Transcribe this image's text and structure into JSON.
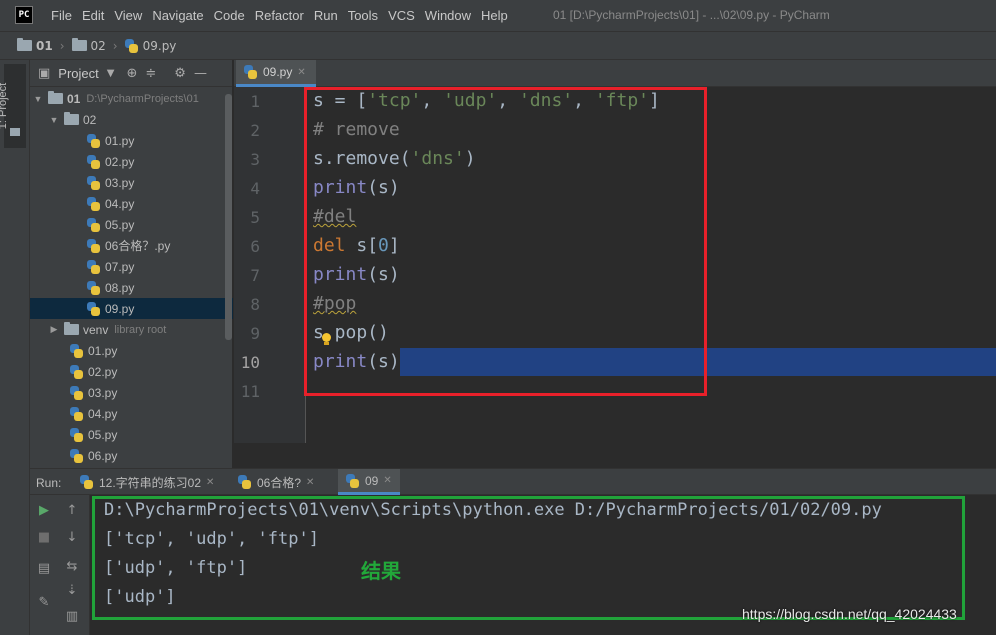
{
  "menubar": {
    "logo": "PC",
    "items": [
      "File",
      "Edit",
      "View",
      "Navigate",
      "Code",
      "Refactor",
      "Run",
      "Tools",
      "VCS",
      "Window",
      "Help"
    ],
    "window_title": "01 [D:\\PycharmProjects\\01] - ...\\02\\09.py - PyCharm"
  },
  "breadcrumb": {
    "root": "01",
    "folder": "02",
    "file": "09.py"
  },
  "left_stripe": {
    "project_tab": "1: Project"
  },
  "project": {
    "title": "Project",
    "root": {
      "name": "01",
      "path": "D:\\PycharmProjects\\01"
    },
    "folder": "02",
    "folder_files": [
      "01.py",
      "02.py",
      "03.py",
      "04.py",
      "05.py",
      "06合格？.py",
      "07.py",
      "08.py",
      "09.py"
    ],
    "venv": {
      "name": "venv",
      "note": "library root"
    },
    "root_files": [
      "01.py",
      "02.py",
      "03.py",
      "04.py",
      "05.py",
      "06.py"
    ]
  },
  "editor": {
    "tab": "09.py",
    "line_numbers": [
      "1",
      "2",
      "3",
      "4",
      "5",
      "6",
      "7",
      "8",
      "9",
      "10",
      "11"
    ],
    "current_line": 10
  },
  "code": {
    "l1": {
      "var": "s = [",
      "a": "'tcp'",
      "c1": ", ",
      "b": "'udp'",
      "c2": ", ",
      "c": "'dns'",
      "c3": ", ",
      "d": "'ftp'",
      "end": "]"
    },
    "l2": "# remove",
    "l3": {
      "pre": "s.remove(",
      "arg": "'dns'",
      "end": ")"
    },
    "l4": {
      "fn": "print",
      "rest": "(s)"
    },
    "l5": "#del",
    "l6": {
      "kw": "del",
      "pre": " s[",
      "num": "0",
      "end": "]"
    },
    "l7": {
      "fn": "print",
      "rest": "(s)"
    },
    "l8": "#pop",
    "l9": {
      "pre": "s",
      "rest": ".pop()"
    },
    "l10": {
      "fn": "print",
      "rest": "(s)"
    }
  },
  "run": {
    "label": "Run:",
    "tabs": [
      "12.字符串的练习02",
      "06合格?",
      "09"
    ],
    "output": [
      "D:\\PycharmProjects\\01\\venv\\Scripts\\python.exe D:/PycharmProjects/01/02/09.py",
      "['tcp', 'udp', 'ftp']",
      "['udp', 'ftp']",
      "['udp']"
    ],
    "annotation": "结果"
  },
  "watermark": "https://blog.csdn.net/qq_42024433",
  "colors": {
    "highlight_red": "#e8202a",
    "highlight_green": "#21a33a",
    "selection": "#214283"
  }
}
